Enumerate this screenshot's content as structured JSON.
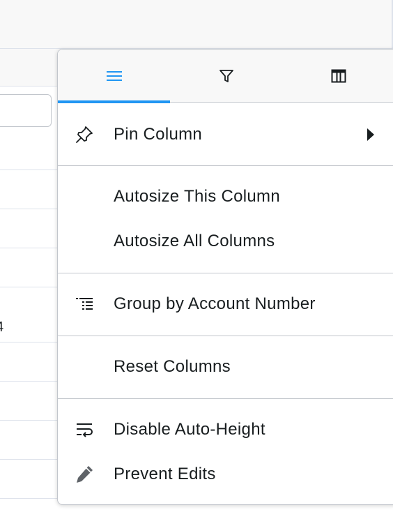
{
  "column_menu": {
    "tabs": [
      {
        "name": "general-menu-tab",
        "icon": "menu-lines-icon",
        "active": true
      },
      {
        "name": "filter-tab",
        "icon": "filter-funnel-icon",
        "active": false
      },
      {
        "name": "columns-tab",
        "icon": "columns-icon",
        "active": false
      }
    ],
    "items": {
      "pin_column": {
        "label": "Pin Column",
        "icon": "pin-icon",
        "has_submenu": true
      },
      "autosize_this": {
        "label": "Autosize This Column"
      },
      "autosize_all": {
        "label": "Autosize All Columns"
      },
      "group_by": {
        "label": "Group by Account Number",
        "icon": "group-list-icon"
      },
      "reset_columns": {
        "label": "Reset Columns"
      },
      "disable_auto_height": {
        "label": "Disable Auto-Height",
        "icon": "text-wrap-icon"
      },
      "prevent_edits": {
        "label": "Prevent Edits",
        "icon": "pencil-icon"
      }
    },
    "accent_color": "#2196f3"
  },
  "grid": {
    "partial_cell_text": "4"
  }
}
